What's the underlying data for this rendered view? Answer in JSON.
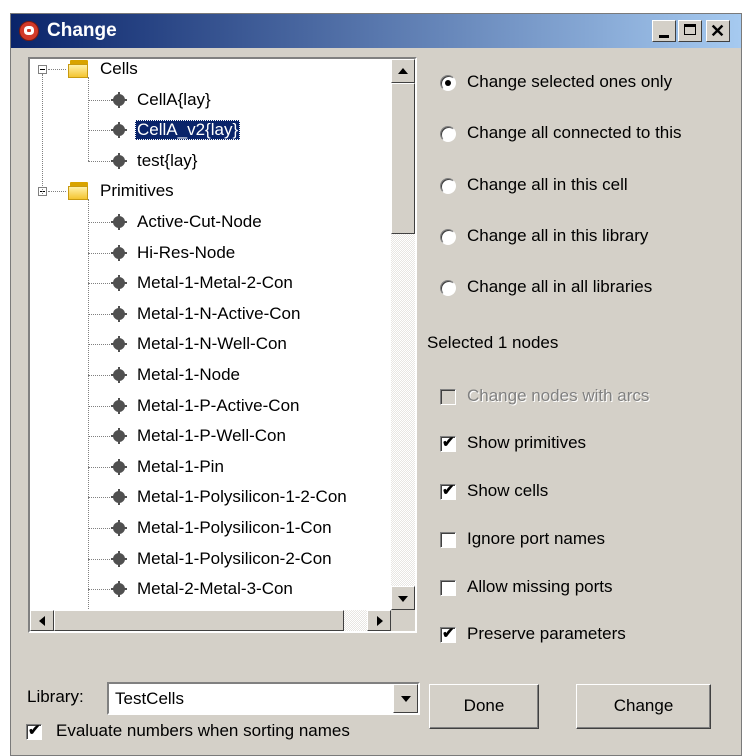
{
  "window": {
    "title": "Change"
  },
  "tree": {
    "rows": [
      {
        "label": "Cells",
        "type": "folder",
        "expanded": true
      },
      {
        "label": "CellA{lay}",
        "type": "item"
      },
      {
        "label": "CellA_v2{lay}",
        "type": "item",
        "selected": true
      },
      {
        "label": "test{lay}",
        "type": "item"
      },
      {
        "label": "Primitives",
        "type": "folder",
        "expanded": true
      },
      {
        "label": "Active-Cut-Node",
        "type": "item"
      },
      {
        "label": "Hi-Res-Node",
        "type": "item"
      },
      {
        "label": "Metal-1-Metal-2-Con",
        "type": "item"
      },
      {
        "label": "Metal-1-N-Active-Con",
        "type": "item"
      },
      {
        "label": "Metal-1-N-Well-Con",
        "type": "item"
      },
      {
        "label": "Metal-1-Node",
        "type": "item"
      },
      {
        "label": "Metal-1-P-Active-Con",
        "type": "item"
      },
      {
        "label": "Metal-1-P-Well-Con",
        "type": "item"
      },
      {
        "label": "Metal-1-Pin",
        "type": "item"
      },
      {
        "label": "Metal-1-Polysilicon-1-2-Con",
        "type": "item"
      },
      {
        "label": "Metal-1-Polysilicon-1-Con",
        "type": "item"
      },
      {
        "label": "Metal-1-Polysilicon-2-Con",
        "type": "item"
      },
      {
        "label": "Metal-2-Metal-3-Con",
        "type": "item"
      }
    ]
  },
  "library": {
    "label": "Library:",
    "value": "TestCells"
  },
  "evaluate_numbers": {
    "label": "Evaluate numbers when sorting names",
    "checked": true
  },
  "scope_options": [
    {
      "label": "Change selected ones only",
      "selected": true
    },
    {
      "label": "Change all connected to this",
      "selected": false
    },
    {
      "label": "Change all in this cell",
      "selected": false
    },
    {
      "label": "Change all in this library",
      "selected": false
    },
    {
      "label": "Change all in all libraries",
      "selected": false
    }
  ],
  "status_text": "Selected 1 nodes",
  "checkboxes": [
    {
      "label": "Change nodes with arcs",
      "checked": false,
      "enabled": false
    },
    {
      "label": "Show primitives",
      "checked": true,
      "enabled": true
    },
    {
      "label": "Show cells",
      "checked": true,
      "enabled": true
    },
    {
      "label": "Ignore port names",
      "checked": false,
      "enabled": true
    },
    {
      "label": "Allow missing ports",
      "checked": false,
      "enabled": true
    },
    {
      "label": "Preserve parameters",
      "checked": true,
      "enabled": true
    }
  ],
  "buttons": {
    "done": "Done",
    "change": "Change"
  },
  "icons": {
    "app": "electric-app-icon",
    "folder": "folder-icon",
    "node": "node-icon",
    "check": "✔"
  },
  "colors": {
    "titlebar_start": "#0a246a",
    "titlebar_end": "#a6caf0",
    "selection": "#0a246a",
    "face": "#d4d0c8"
  }
}
